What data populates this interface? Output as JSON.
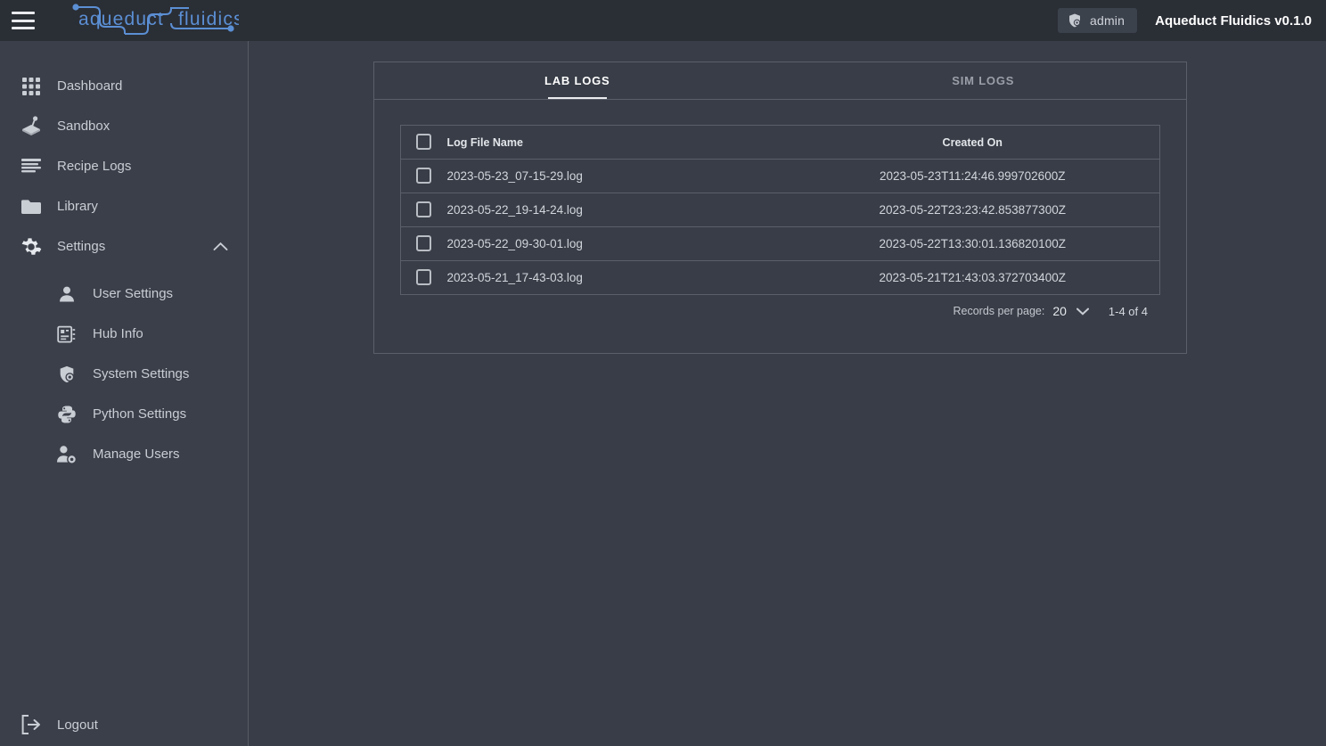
{
  "header": {
    "menu_icon": "hamburger-icon",
    "logo_text": "aqueduct fluidics",
    "admin_label": "admin",
    "admin_icon": "shield-account-icon",
    "app_version": "Aqueduct Fluidics v0.1.0"
  },
  "sidebar": {
    "items": [
      {
        "label": "Dashboard",
        "icon": "grid-icon"
      },
      {
        "label": "Sandbox",
        "icon": "joystick-icon"
      },
      {
        "label": "Recipe Logs",
        "icon": "list-lines-icon"
      },
      {
        "label": "Library",
        "icon": "folder-icon"
      },
      {
        "label": "Settings",
        "icon": "gear-icon",
        "chevron": "chevron-up-icon"
      }
    ],
    "sub_items": [
      {
        "label": "User Settings",
        "icon": "person-icon"
      },
      {
        "label": "Hub Info",
        "icon": "hub-chip-icon"
      },
      {
        "label": "System Settings",
        "icon": "shield-gear-icon"
      },
      {
        "label": "Python Settings",
        "icon": "python-icon"
      },
      {
        "label": "Manage Users",
        "icon": "person-gear-icon"
      }
    ],
    "logout": {
      "label": "Logout",
      "icon": "logout-icon"
    }
  },
  "main": {
    "tabs": [
      {
        "label": "LAB LOGS",
        "active": true
      },
      {
        "label": "SIM LOGS",
        "active": false
      }
    ],
    "table": {
      "select_all_checkbox": "select-all-checkbox",
      "columns": [
        "Log File Name",
        "Created On"
      ],
      "rows": [
        {
          "name": "2023-05-23_07-15-29.log",
          "created_on": "2023-05-23T11:24:46.999702600Z"
        },
        {
          "name": "2023-05-22_19-14-24.log",
          "created_on": "2023-05-22T23:23:42.853877300Z"
        },
        {
          "name": "2023-05-22_09-30-01.log",
          "created_on": "2023-05-22T13:30:01.136820100Z"
        },
        {
          "name": "2023-05-21_17-43-03.log",
          "created_on": "2023-05-21T21:43:03.372703400Z"
        }
      ]
    },
    "pagination": {
      "records_label": "Records per page:",
      "records_value": "20",
      "range": "1-4 of 4"
    }
  },
  "colors": {
    "header_bg": "#2a2e35",
    "sidebar_bg": "#3a3f49",
    "content_bg": "#383d47",
    "border": "#5a5f69",
    "text_primary": "#e3e6ea",
    "text_secondary": "#9a9fa8",
    "logo_blue": "#5b8fd4"
  }
}
